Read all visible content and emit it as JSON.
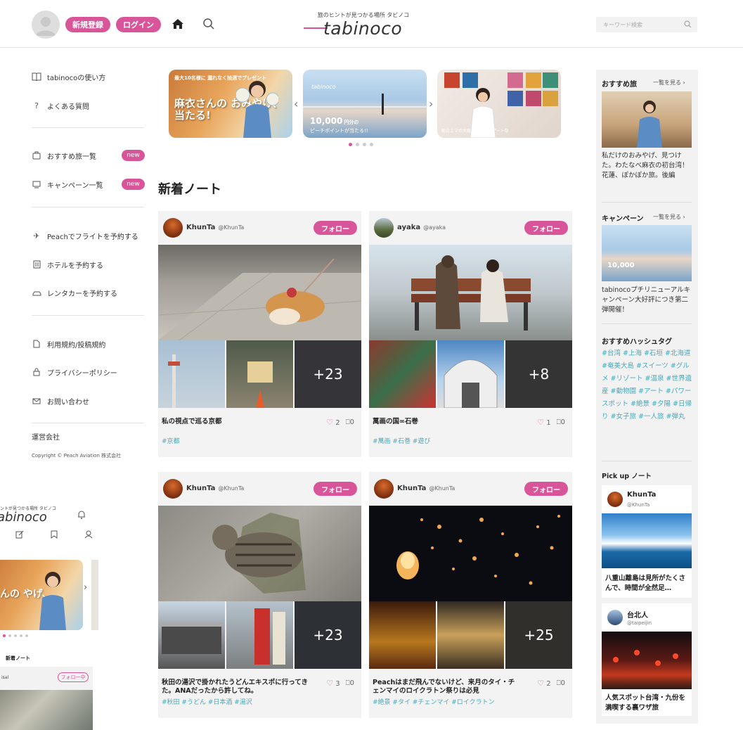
{
  "header": {
    "register_label": "新規登録",
    "login_label": "ログイン",
    "tagline": "旅のヒントが見つかる場所 タビノコ",
    "logo_text": "tabinoco",
    "search_placeholder": "キーワード検索"
  },
  "left_nav": {
    "help": [
      {
        "icon": "book-icon",
        "label": "tabinocoの使い方"
      },
      {
        "icon": "question-icon",
        "label": "よくある質問"
      }
    ],
    "lists": [
      {
        "icon": "suitcase-icon",
        "label": "おすすめ旅一覧",
        "badge": "new"
      },
      {
        "icon": "monitor-icon",
        "label": "キャンペーン一覧",
        "badge": "new"
      }
    ],
    "booking": [
      {
        "icon": "plane-icon",
        "label": "Peachでフライトを予約する"
      },
      {
        "icon": "hotel-icon",
        "label": "ホテルを予約する"
      },
      {
        "icon": "car-icon",
        "label": "レンタカーを予約する"
      }
    ],
    "legal": [
      {
        "icon": "document-icon",
        "label": "利用規約/投稿規約"
      },
      {
        "icon": "lock-icon",
        "label": "プライバシーポリシー"
      },
      {
        "icon": "mail-icon",
        "label": "お問い合わせ"
      }
    ],
    "operator": "運営会社",
    "copyright": "Copyright © Peach Aviation 株式会社"
  },
  "carousel": {
    "banner1": {
      "top": "最大10名様に 漏れなく抽選でプレゼント",
      "text": "麻衣さんの おみやげ、 当たる!"
    },
    "banner2": {
      "brand": "tabinoco",
      "amount": "10,000",
      "unit": "円分の",
      "sub": "ピーチポイントが当たる!!"
    },
    "banner3": {
      "text": "朝日エマの大阪、市民の日アート祭"
    },
    "pages": 4,
    "active_page": 0
  },
  "section_title": "新着ノート",
  "notes": [
    {
      "user": "KhunTa",
      "handle": "@KhunTa",
      "follow": "フォロー",
      "more": "+23",
      "title": "私の視点で巡る京都",
      "likes": "2",
      "saves": "0",
      "tags": "#京都"
    },
    {
      "user": "ayaka",
      "handle": "@ayaka",
      "follow": "フォロー",
      "more": "+8",
      "title": "萬画の国∞石巻",
      "likes": "1",
      "saves": "0",
      "tags": "#萬画 #石巻 #遊び"
    },
    {
      "user": "KhunTa",
      "handle": "@KhunTa",
      "follow": "フォロー",
      "more": "+23",
      "title": "秋田の湯沢で掛かれたうどんエキスポに行ってきた。ANAだったから許してね。",
      "likes": "3",
      "saves": "0",
      "tags": "#秋田 #うどん #日本酒 #湯沢"
    },
    {
      "user": "KhunTa",
      "handle": "@KhunTa",
      "follow": "フォロー",
      "more": "+25",
      "title": "Peachはまだ飛んでないけど、来月のタイ・チェンマイのロイクラトン祭りは必見",
      "likes": "2",
      "saves": "0",
      "tags": "#絶景 #タイ #チェンマイ #ロイクラトン"
    }
  ],
  "right_sidebar": {
    "recommended_title": "おすすめ旅",
    "see_all": "一覧を見る ›",
    "recommended_text": "私だけのおみやげ、見つけた。わたなべ麻衣の初台湾！花蓮、ぽかぽか旅。後編",
    "campaign_title": "キャンペーン",
    "campaign_see_all": "一覧を見る ›",
    "campaign_text": "tabinocoプチリニューアルキャンペーン大好評につき第二弾開催！",
    "hashtag_title": "おすすめハッシュタグ",
    "hashtags": "#台湾 #上海 #石垣 #北海道 #奄美大島 #スイーツ #グルメ #リゾート #温泉 #世界遺産 #動物園 #アート #パワースポット #絶景 #夕陽 #日帰り #女子旅 #一人旅 #弾丸",
    "pickup_title": "Pick up ノート",
    "pickups": [
      {
        "user": "KhunTa",
        "handle": "@KhunTa",
        "text": "八重山離島は見所がたくさんで、時間が全然足…"
      },
      {
        "user": "台北人",
        "handle": "@taipeijin",
        "text": "人気スポット台湾・九份を満喫する裏ワザ旅"
      }
    ]
  },
  "mobile_preview": {
    "tagline": "ントが見つかる場所 タビノコ",
    "logo_text": "abinoco",
    "banner_text": "んの やげ、",
    "section_title": "新着ノート",
    "user": "isal",
    "follow": "フォロー中"
  },
  "colors": {
    "accent": "#d9559a",
    "tag": "#4aa7b8"
  }
}
